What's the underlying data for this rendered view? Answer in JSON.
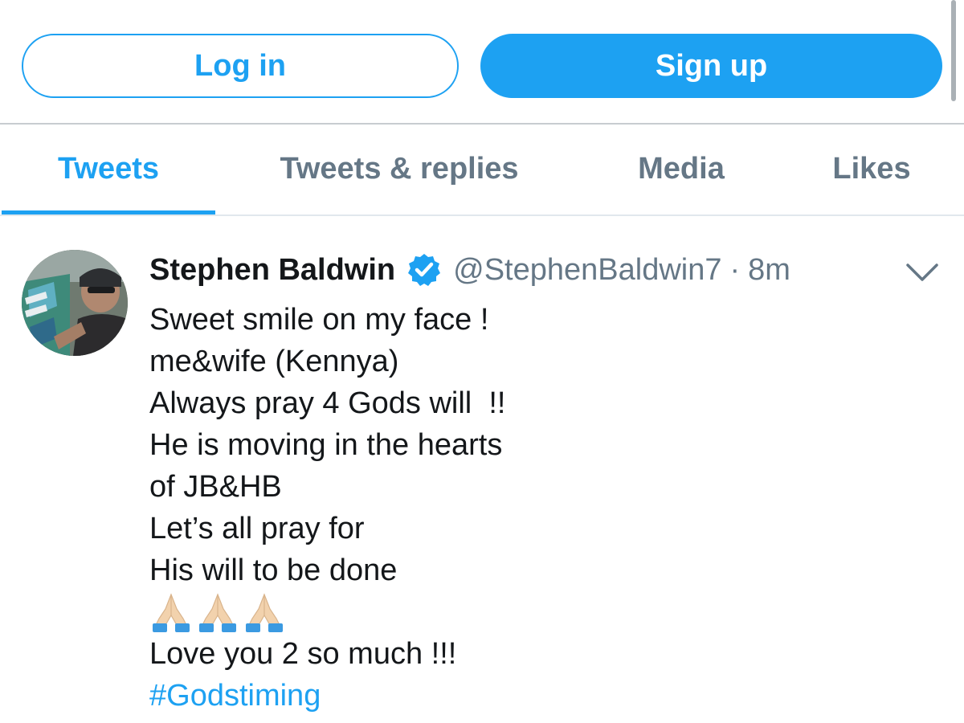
{
  "auth": {
    "login_label": "Log in",
    "signup_label": "Sign up"
  },
  "tabs": [
    {
      "label": "Tweets",
      "active": true
    },
    {
      "label": "Tweets & replies",
      "active": false
    },
    {
      "label": "Media",
      "active": false
    },
    {
      "label": "Likes",
      "active": false
    }
  ],
  "tweet": {
    "name": "Stephen Baldwin",
    "verified": true,
    "handle": "@StephenBaldwin7",
    "separator": "·",
    "time": "8m",
    "lines": [
      "Sweet smile on my face !",
      "me&wife (Kennya)",
      "Always pray 4 Gods will  !!",
      "He is moving in the hearts",
      "of JB&HB",
      "Let’s all pray for",
      "His will to be done"
    ],
    "emoji": [
      "folded-hands-icon",
      "folded-hands-icon",
      "folded-hands-icon"
    ],
    "closing_line": "Love you 2 so much !!!",
    "hashtag": "#Godstiming"
  },
  "colors": {
    "accent": "#1da1f2",
    "text": "#14171a",
    "muted": "#657786"
  }
}
